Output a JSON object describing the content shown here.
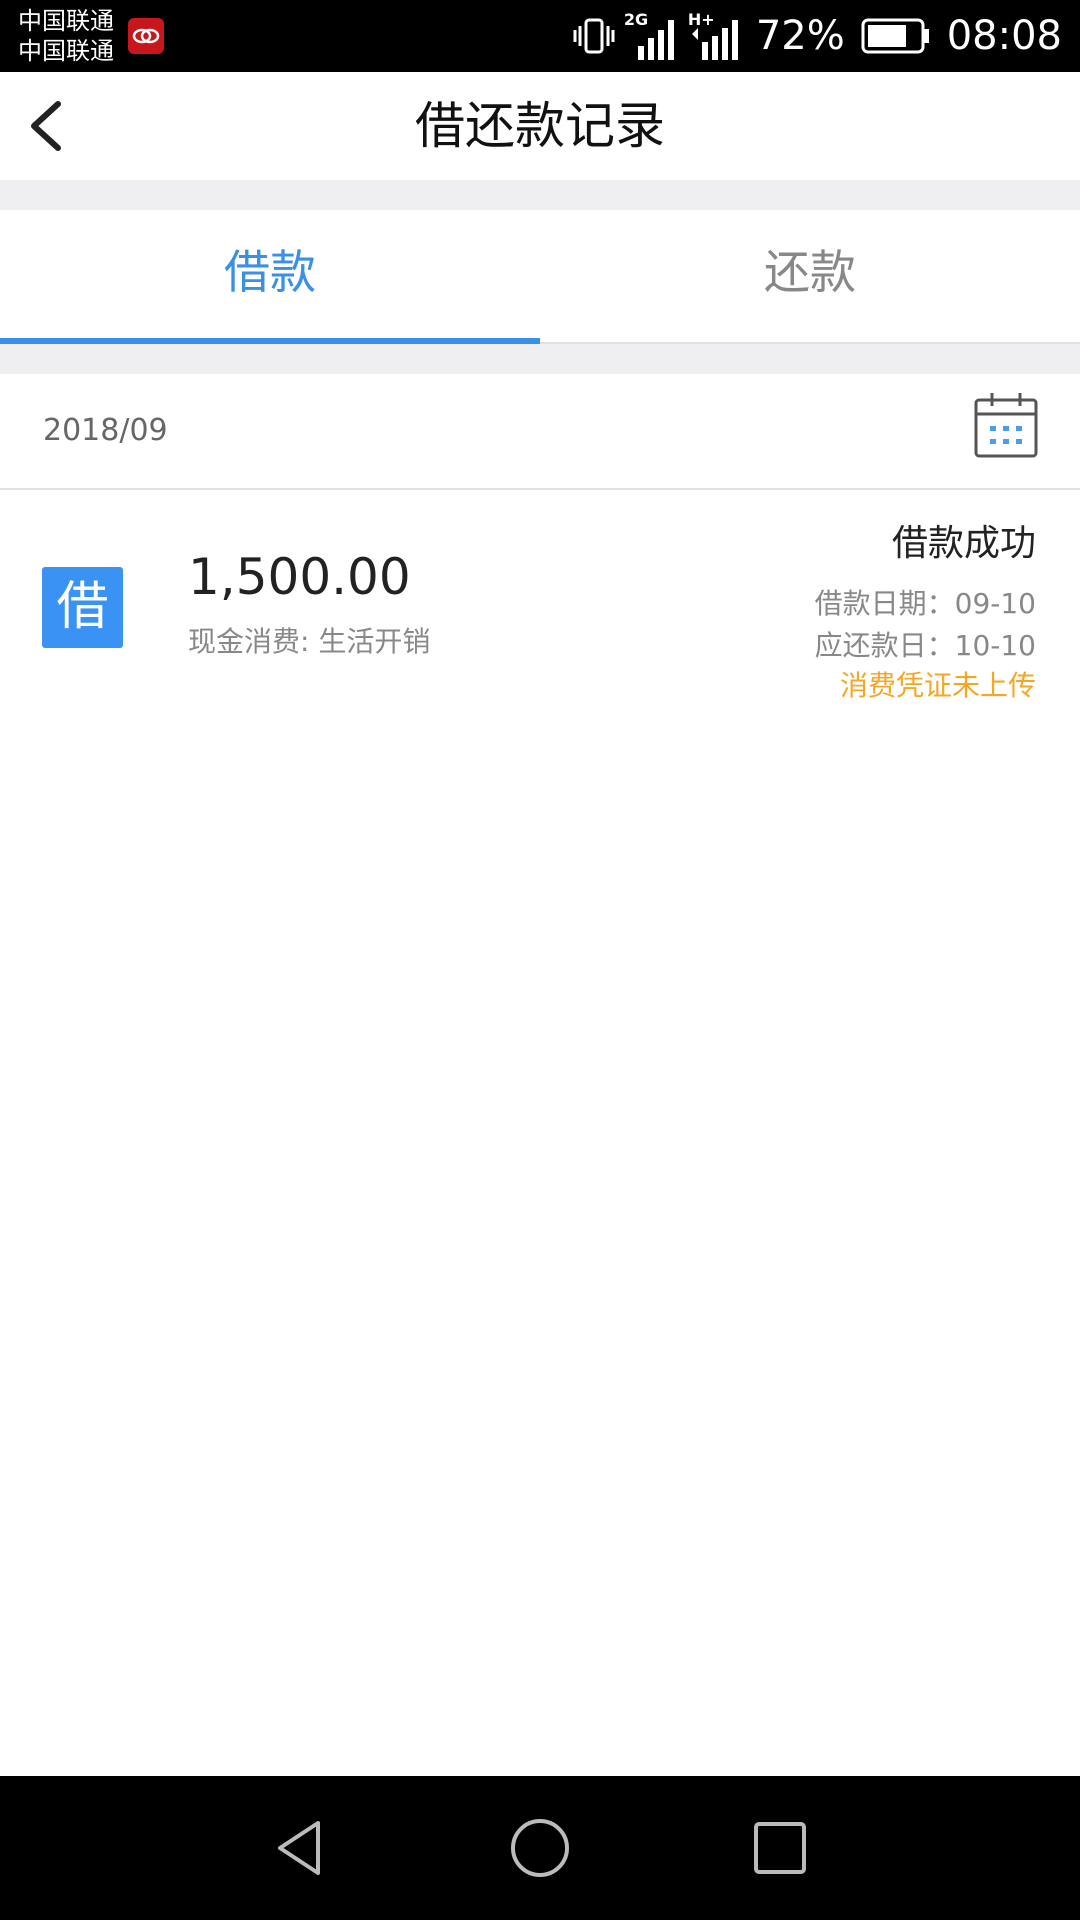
{
  "status_bar": {
    "carrier_1": "中国联通",
    "carrier_2": "中国联通",
    "network_label": "2G",
    "network_label_2": "H+",
    "battery": "72%",
    "time": "08:08",
    "icons": [
      "carrier-app-icon",
      "vibrate-icon",
      "signal-icon",
      "signal-icon",
      "battery-icon"
    ]
  },
  "header": {
    "title": "借还款记录",
    "back_icon": "chevron-left-icon"
  },
  "tabs": [
    {
      "label": "借款",
      "active": true
    },
    {
      "label": "还款",
      "active": false
    }
  ],
  "month": {
    "label": "2018/09",
    "calendar_icon": "calendar-icon"
  },
  "records": [
    {
      "badge": "借",
      "amount": "1,500.00",
      "purpose": "现金消费: 生活开销",
      "status": "借款成功",
      "borrow_date": "借款日期：09-10",
      "due_date": "应还款日：10-10",
      "note": "消费凭证未上传"
    }
  ],
  "colors": {
    "accent": "#3a8fe6",
    "badge": "#3a93f4",
    "warning": "#f5a623",
    "divider": "#efeff2"
  },
  "nav_bar": {
    "icons": [
      "back-triangle-icon",
      "home-circle-icon",
      "recent-square-icon"
    ]
  }
}
